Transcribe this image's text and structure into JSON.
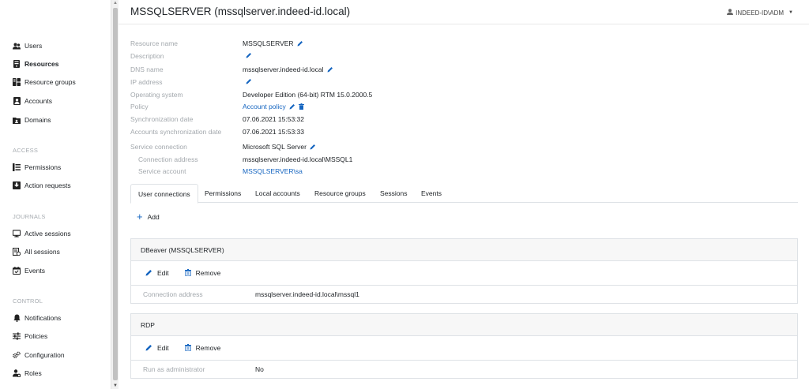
{
  "header": {
    "title": "MSSQLSERVER (mssqlserver.indeed-id.local)",
    "user": "INDEED-ID\\ADM"
  },
  "sidebar": {
    "items_main": [
      {
        "label": "Users",
        "icon": "users-icon"
      },
      {
        "label": "Resources",
        "icon": "server-icon",
        "active": true
      },
      {
        "label": "Resource groups",
        "icon": "resource-groups-icon"
      },
      {
        "label": "Accounts",
        "icon": "account-icon"
      },
      {
        "label": "Domains",
        "icon": "domain-icon"
      }
    ],
    "section_access": "ACCESS",
    "items_access": [
      {
        "label": "Permissions",
        "icon": "permissions-icon"
      },
      {
        "label": "Action requests",
        "icon": "action-requests-icon"
      }
    ],
    "section_journals": "JOURNALS",
    "items_journals": [
      {
        "label": "Active sessions",
        "icon": "monitor-icon"
      },
      {
        "label": "All sessions",
        "icon": "sessions-icon"
      },
      {
        "label": "Events",
        "icon": "calendar-check-icon"
      }
    ],
    "section_control": "CONTROL",
    "items_control": [
      {
        "label": "Notifications",
        "icon": "bell-icon"
      },
      {
        "label": "Policies",
        "icon": "sliders-icon"
      },
      {
        "label": "Configuration",
        "icon": "gears-icon"
      },
      {
        "label": "Roles",
        "icon": "roles-icon"
      }
    ]
  },
  "details": {
    "resource_name_label": "Resource name",
    "resource_name": "MSSQLSERVER",
    "description_label": "Description",
    "description": "",
    "dns_name_label": "DNS name",
    "dns_name": "mssqlserver.indeed-id.local",
    "ip_address_label": "IP address",
    "ip_address": "",
    "os_label": "Operating system",
    "os": "Developer Edition (64-bit) RTM 15.0.2000.5",
    "policy_label": "Policy",
    "policy": "Account policy",
    "sync_date_label": "Synchronization date",
    "sync_date": "07.06.2021 15:53:32",
    "accounts_sync_label": "Accounts synchronization date",
    "accounts_sync": "07.06.2021 15:53:33",
    "service_connection_label": "Service connection",
    "service_connection": "Microsoft SQL Server",
    "connection_address_label": "Connection address",
    "connection_address": "mssqlserver.indeed-id.local\\MSSQL1",
    "service_account_label": "Service account",
    "service_account": "MSSQLSERVER\\sa"
  },
  "tabs": [
    {
      "label": "User connections",
      "active": true
    },
    {
      "label": "Permissions"
    },
    {
      "label": "Local accounts"
    },
    {
      "label": "Resource groups"
    },
    {
      "label": "Sessions"
    },
    {
      "label": "Events"
    }
  ],
  "add_label": "Add",
  "connections": [
    {
      "title": "DBeaver (MSSQLSERVER)",
      "edit_label": "Edit",
      "remove_label": "Remove",
      "row_key": "Connection address",
      "row_value": "mssqlserver.indeed-id.local\\mssql1"
    },
    {
      "title": "RDP",
      "edit_label": "Edit",
      "remove_label": "Remove",
      "row_key": "Run as administrator",
      "row_value": "No"
    }
  ],
  "colors": {
    "accent": "#1565c0",
    "label_gray": "#a3a8ad",
    "border": "#dee2e6"
  }
}
